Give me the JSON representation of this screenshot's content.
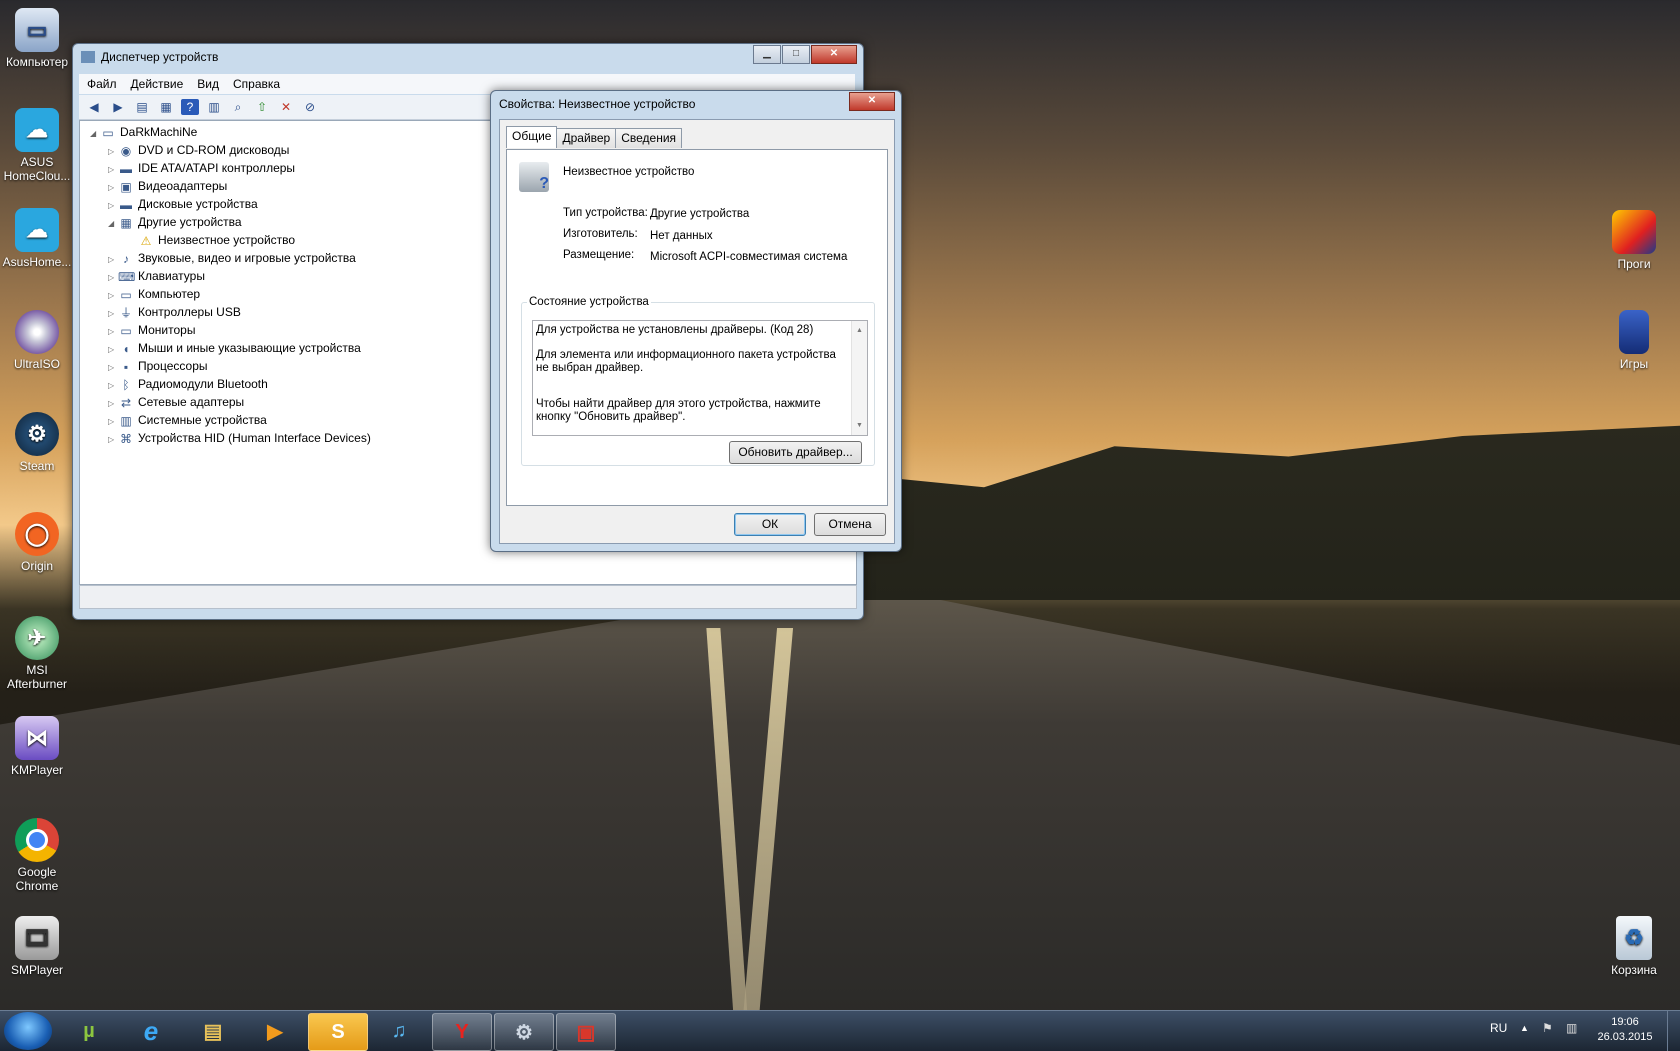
{
  "desktop": {
    "icons_left": [
      {
        "label": "Компьютер",
        "icon": "computer-icon"
      },
      {
        "label": "ASUS HomeClou...",
        "icon": "asus-cloud-icon"
      },
      {
        "label": "AsusHome...",
        "icon": "asus-cloud-icon"
      },
      {
        "label": "UltraISO",
        "icon": "disc-icon"
      },
      {
        "label": "Steam",
        "icon": "steam-icon"
      },
      {
        "label": "Origin",
        "icon": "origin-icon"
      },
      {
        "label": "MSI Afterburner",
        "icon": "afterburner-icon"
      },
      {
        "label": "KMPlayer",
        "icon": "kmplayer-icon"
      },
      {
        "label": "Google Chrome",
        "icon": "chrome-icon"
      },
      {
        "label": "SMPlayer",
        "icon": "smplayer-icon"
      }
    ],
    "icons_right": [
      {
        "label": "Проги",
        "icon": "folder-icon"
      },
      {
        "label": "Игры",
        "icon": "book-icon"
      },
      {
        "label": "Корзина",
        "icon": "recycle-bin-icon"
      }
    ]
  },
  "device_manager": {
    "title": "Диспетчер устройств",
    "menu": [
      "Файл",
      "Действие",
      "Вид",
      "Справка"
    ],
    "tree": {
      "root": "DaRkMachiNe",
      "items": [
        "DVD и CD-ROM дисководы",
        "IDE ATA/ATAPI контроллеры",
        "Видеоадаптеры",
        "Дисковые устройства",
        "Другие устройства",
        "Неизвестное устройство",
        "Звуковые, видео и игровые устройства",
        "Клавиатуры",
        "Компьютер",
        "Контроллеры USB",
        "Мониторы",
        "Мыши и иные указывающие устройства",
        "Процессоры",
        "Радиомодули Bluetooth",
        "Сетевые адаптеры",
        "Системные устройства",
        "Устройства HID (Human Interface Devices)"
      ]
    }
  },
  "properties_dialog": {
    "title": "Свойства: Неизвестное устройство",
    "tabs": [
      "Общие",
      "Драйвер",
      "Сведения"
    ],
    "device_name": "Неизвестное устройство",
    "fields": [
      {
        "label": "Тип устройства:",
        "value": "Другие устройства"
      },
      {
        "label": "Изготовитель:",
        "value": "Нет данных"
      },
      {
        "label": "Размещение:",
        "value": "Microsoft ACPI-совместимая система"
      }
    ],
    "status_group_label": "Состояние устройства",
    "status_lines": [
      "Для устройства не установлены драйверы. (Код 28)",
      "Для элемента или информационного пакета устройства не выбран драйвер.",
      "Чтобы найти драйвер для этого устройства, нажмите кнопку \"Обновить драйвер\"."
    ],
    "update_button": "Обновить драйвер...",
    "ok_button": "ОК",
    "cancel_button": "Отмена"
  },
  "taskbar": {
    "language": "RU",
    "time": "19:06",
    "date": "26.03.2015"
  }
}
